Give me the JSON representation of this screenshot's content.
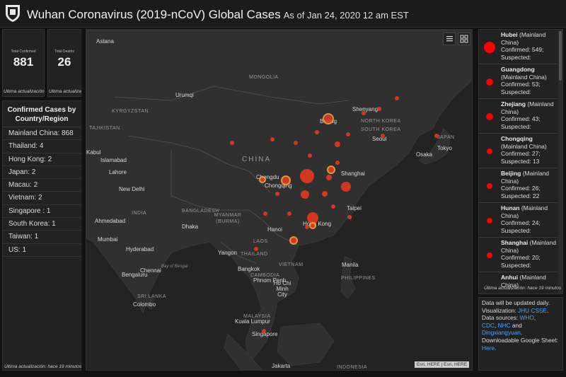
{
  "header": {
    "title": "Wuhan Coronavirus (2019-nCoV) Global Cases",
    "subtitle": "As of Jan 24, 2020 12 am EST"
  },
  "kpis": [
    {
      "label": "Total Confirmed",
      "value": "881",
      "footer": "Última actualización: hace 19 minutos"
    },
    {
      "label": "Total Deaths",
      "value": "26",
      "footer": "Última actualización: hace 19 minutos"
    }
  ],
  "country_list": {
    "title": "Confirmed Cases by Country/Region",
    "rows": [
      "Mainland China:  868",
      "Thailand:  4",
      "Hong Kong:  2",
      "Japan:  2",
      "Macau:  2",
      "Vietnam:  2",
      "Singapore :  1",
      "South Korea:  1",
      "Taiwan:  1",
      "US:  1"
    ],
    "footer": "Última actualización: hace 19 minutos"
  },
  "map": {
    "labels": {
      "astana": "Astana",
      "mongolia": "MONGOLIA",
      "urumqi": "Urumqi",
      "kyrgyzstan": "KYRGYZSTAN",
      "tajikistan": "TAJIKISTAN",
      "kabul": "Kabul",
      "islamabad": "Islamabad",
      "lahore": "Lahore",
      "china": "CHINA",
      "newdelhi": "New Delhi",
      "india": "INDIA",
      "bangladesh": "BANGLADESH",
      "myanmar": "MYANMAR (BURMA)",
      "ahmedabad": "Ahmedabad",
      "mumbai": "Mumbai",
      "hyderabad": "Hyderabad",
      "bengaluru": "Bengaluru",
      "chennai": "Chennai",
      "bayofbengal": "Bay of Bengal",
      "srilanka": "SRI LANKA",
      "colombo": "Colombo",
      "dhaka": "Dhaka",
      "yangon": "Yangon",
      "hanoi": "Hanoi",
      "laos": "LAOS",
      "thailand": "THAILAND",
      "bangkok": "Bangkok",
      "cambodia": "CAMBODIA",
      "phnompenh": "Phnom Penh",
      "vietnam": "VIETNAM",
      "hochiminh": "Ho Chi Minh City",
      "malaysia": "MALAYSIA",
      "kualalumpur": "Kuala Lumpur",
      "singapore": "Singapore",
      "indonesia": "INDONESIA",
      "jakarta": "Jakarta",
      "manila": "Manila",
      "philippines": "PHILIPPINES",
      "taipei": "Taipei",
      "hongkong": "Hong Kong",
      "chengdu": "Chengdu",
      "chongqing": "Chongqing",
      "beijing": "Beijing",
      "shanghai": "Shanghai",
      "shenyang": "Shenyang",
      "northkorea": "NORTH KOREA",
      "southkorea": "SOUTH KOREA",
      "seoul": "Seoul",
      "japan": "JAPAN",
      "osaka": "Osaka",
      "tokyo": "Tokyo"
    },
    "attribution": "Esri, HERE | Esri, HERE"
  },
  "provinces": [
    {
      "name": "Hubei",
      "region": " (Mainland China)",
      "detail": "Confirmed: 549; Suspected:"
    },
    {
      "name": "Guangdong",
      "region": " (Mainland China)",
      "detail": "Confirmed: 53; Suspected:"
    },
    {
      "name": "Zhejiang",
      "region": " (Mainland China)",
      "detail": "Confirmed: 43; Suspected:"
    },
    {
      "name": "Chongqing",
      "region": " (Mainland China)",
      "detail": "Confirmed: 27; Suspected: 13"
    },
    {
      "name": "Beijing",
      "region": " (Mainland China)",
      "detail": "Confirmed: 26; Suspected: 22"
    },
    {
      "name": "Hunan",
      "region": " (Mainland China)",
      "detail": "Confirmed: 24; Suspected:"
    },
    {
      "name": "Shanghai",
      "region": " (Mainland China)",
      "detail": "Confirmed: 20; Suspected:"
    },
    {
      "name": "Anhui",
      "region": " (Mainland China)",
      "detail": ""
    }
  ],
  "provinces_footer": "Última actualización: hace 19 minutos",
  "info": {
    "line1": "Data will be updated daily.",
    "viz_label": "Visualization: ",
    "viz_link": "JHU CSSE",
    "viz_end": ".",
    "sources_label": "Data sources: ",
    "who": "WHO",
    "comma": ",",
    "cdc": "CDC",
    "nhc": "NHC",
    "and": " and",
    "dxy": "Dingxiangyuan",
    "period": ".",
    "sheet_text": "Downloadable Google Sheet: ",
    "here": "Here",
    "end": "."
  },
  "colors": {
    "accent": "#ff0000",
    "link": "#4aa3ff"
  }
}
